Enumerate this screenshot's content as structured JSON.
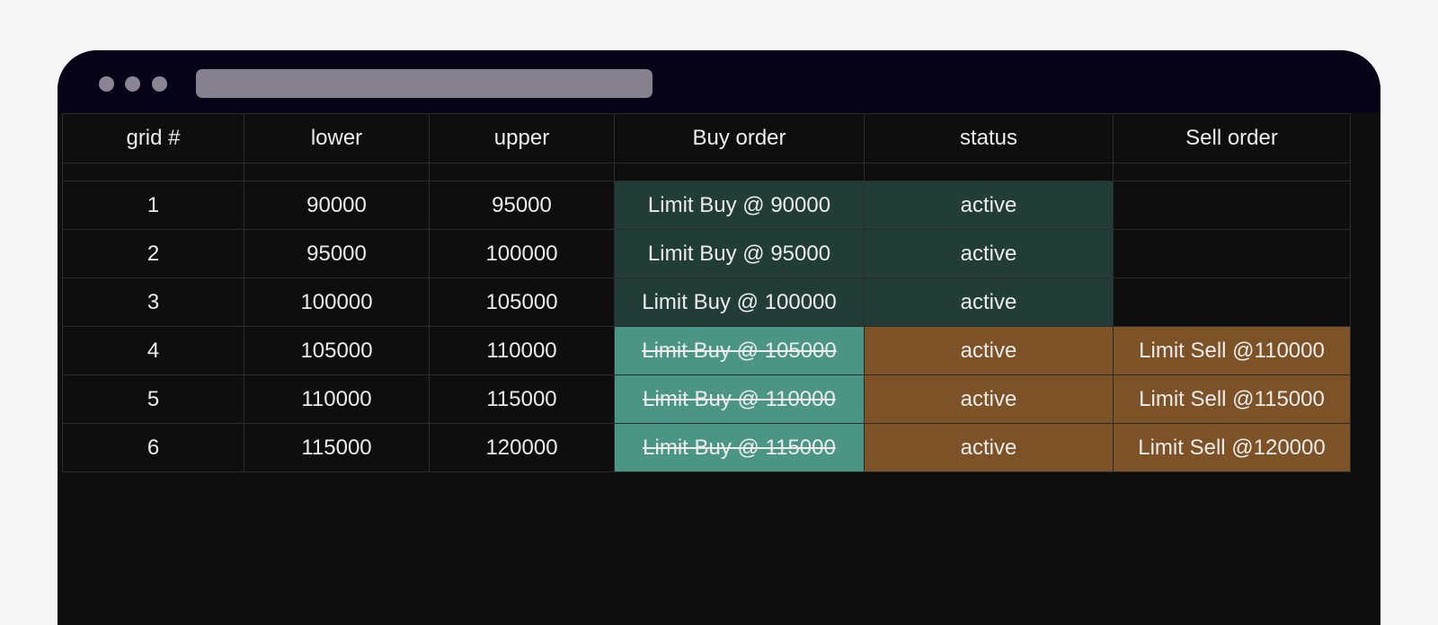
{
  "table": {
    "headers": [
      "grid #",
      "lower",
      "upper",
      "Buy order",
      "status",
      "Sell order"
    ],
    "rows": [
      {
        "grid": "1",
        "lower": "90000",
        "upper": "95000",
        "buy": "Limit Buy @ 90000",
        "status": "active",
        "sell": ""
      },
      {
        "grid": "2",
        "lower": "95000",
        "upper": "100000",
        "buy": "Limit Buy @ 95000",
        "status": "active",
        "sell": ""
      },
      {
        "grid": "3",
        "lower": "100000",
        "upper": "105000",
        "buy": "Limit Buy @ 100000",
        "status": "active",
        "sell": ""
      },
      {
        "grid": "4",
        "lower": "105000",
        "upper": "110000",
        "buy": "Limit Buy @ 105000",
        "status": "active",
        "sell": "Limit Sell @110000"
      },
      {
        "grid": "5",
        "lower": "110000",
        "upper": "115000",
        "buy": "Limit Buy @ 110000",
        "status": "active",
        "sell": "Limit Sell @115000"
      },
      {
        "grid": "6",
        "lower": "115000",
        "upper": "120000",
        "buy": "Limit Buy @ 115000",
        "status": "active",
        "sell": "Limit Sell @120000"
      }
    ]
  },
  "colors": {
    "buy_active": "#223d38",
    "buy_filled": "#4a9584",
    "sell_active": "#7e5227",
    "titlebar": "#060218"
  }
}
